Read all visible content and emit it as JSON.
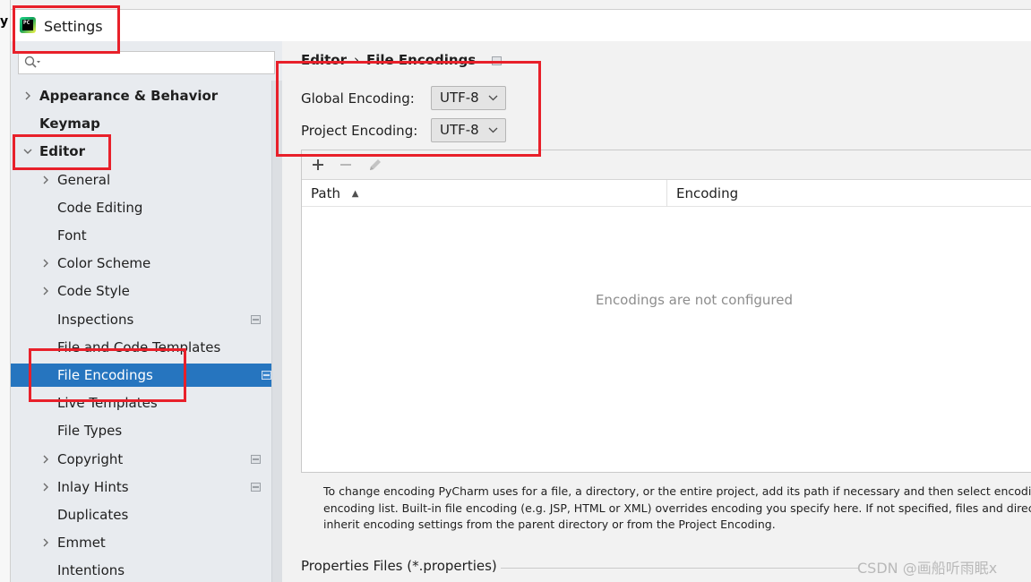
{
  "window": {
    "title": "Settings"
  },
  "search": {
    "placeholder": ""
  },
  "sidebar": {
    "items": [
      {
        "label": "Appearance & Behavior",
        "bold": true,
        "expander": "right"
      },
      {
        "label": "Keymap",
        "bold": true,
        "expander": "none"
      },
      {
        "label": "Editor",
        "bold": true,
        "expander": "down"
      },
      {
        "label": "General",
        "bold": false,
        "expander": "right"
      },
      {
        "label": "Code Editing",
        "bold": false,
        "expander": "none"
      },
      {
        "label": "Font",
        "bold": false,
        "expander": "none"
      },
      {
        "label": "Color Scheme",
        "bold": false,
        "expander": "right"
      },
      {
        "label": "Code Style",
        "bold": false,
        "expander": "right"
      },
      {
        "label": "Inspections",
        "bold": false,
        "expander": "none",
        "project_icon": true
      },
      {
        "label": "File and Code Templates",
        "bold": false,
        "expander": "none"
      },
      {
        "label": "File Encodings",
        "bold": false,
        "expander": "none",
        "project_icon": true,
        "selected": true
      },
      {
        "label": "Live Templates",
        "bold": false,
        "expander": "none"
      },
      {
        "label": "File Types",
        "bold": false,
        "expander": "none"
      },
      {
        "label": "Copyright",
        "bold": false,
        "expander": "right",
        "project_icon": true
      },
      {
        "label": "Inlay Hints",
        "bold": false,
        "expander": "right",
        "project_icon": true
      },
      {
        "label": "Duplicates",
        "bold": false,
        "expander": "none"
      },
      {
        "label": "Emmet",
        "bold": false,
        "expander": "right"
      },
      {
        "label": "Intentions",
        "bold": false,
        "expander": "none"
      }
    ]
  },
  "breadcrumb": {
    "parent": "Editor",
    "separator": "›",
    "current": "File Encodings"
  },
  "global_encoding": {
    "label": "Global Encoding:",
    "value": "UTF-8"
  },
  "project_encoding": {
    "label": "Project Encoding:",
    "value": "UTF-8"
  },
  "table": {
    "toolbar": [
      "add-icon",
      "remove-icon",
      "edit-icon"
    ],
    "columns": [
      "Path",
      "Encoding"
    ],
    "sort_indicator": "▲",
    "empty_text": "Encodings are not configured"
  },
  "help": {
    "line1": "To change encoding PyCharm uses for a file, a directory, or the entire project, add its path if necessary and then select encoding",
    "line2": "encoding list. Built-in file encoding (e.g. JSP, HTML or XML) overrides encoding you specify here. If not specified, files and directo",
    "line3": "inherit encoding settings from the parent directory or from the Project Encoding."
  },
  "properties": {
    "label": "Properties Files (*.properties)"
  },
  "watermark": "CSDN @画船听雨眠x",
  "colors": {
    "selection": "#2675bf",
    "highlight": "#e8202a",
    "sidebar_bg": "#e8ebef"
  }
}
